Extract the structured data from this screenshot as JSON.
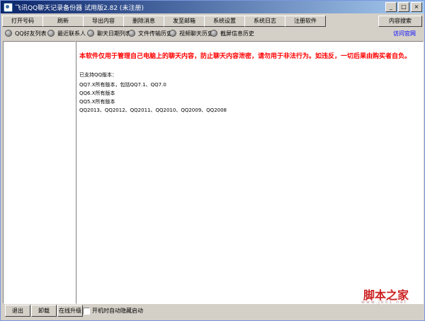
{
  "window": {
    "title": "飞讯QQ聊天记录备份器 试用版2.82 (未注册)",
    "controls": {
      "minimize": "_",
      "maximize": "□",
      "close": "×"
    }
  },
  "toolbar": {
    "buttons": [
      "打开号码",
      "刷新",
      "导出内容",
      "删除消息",
      "发至邮箱",
      "系统设置",
      "系统日志",
      "注册软件"
    ],
    "search_label": "内容搜索"
  },
  "radiobar": {
    "items": [
      "QQ好友列表",
      "最近联系人",
      "聊天日期列表",
      "文件传输历史",
      "视频聊天历史",
      "截屏信息历史"
    ],
    "link": "访问官网"
  },
  "content": {
    "warning": "本软件仅用于管理自己电脑上的聊天内容，防止聊天内容泄密，请勿用于非法行为。如违反，一切后果由购买者自负。",
    "supported_heading": "已支持QQ版本：",
    "lines": [
      "QQ7.X所有版本，包括QQ7.1、QQ7.0",
      "QQ6.X所有版本",
      "QQ5.X所有版本",
      "QQ2013、QQ2012、QQ2011、QQ2010、QQ2009、QQ2008"
    ],
    "watermark": "脚本之家",
    "watermark_url": "www.jb51.net"
  },
  "bottom": {
    "exit": "退出",
    "uninstall": "卸载",
    "upgrade": "在线升级",
    "autostart": "开机时自动隐藏启动"
  }
}
